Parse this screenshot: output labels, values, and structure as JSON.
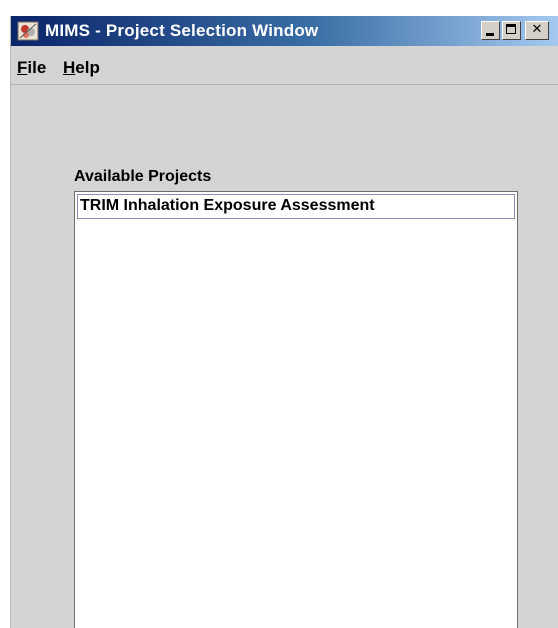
{
  "window": {
    "title": "MIMS - Project Selection Window",
    "controls": {
      "minimize": "minimize",
      "maximize": "maximize",
      "close": "✕"
    }
  },
  "menu": {
    "file": {
      "mnemonic": "F",
      "rest": "ile"
    },
    "help": {
      "mnemonic": "H",
      "rest": "elp"
    }
  },
  "projects": {
    "label": "Available Projects",
    "items": [
      {
        "label": "TRIM Inhalation Exposure Assessment"
      }
    ]
  },
  "icons": {
    "app": "mims-app-icon",
    "minimize": "minimize-icon",
    "maximize": "maximize-icon",
    "close": "close-icon"
  },
  "colors": {
    "titlebar_start": "#0a246a",
    "titlebar_end": "#a6caf0",
    "window_bg": "#d4d4d4",
    "list_bg": "#ffffff"
  }
}
